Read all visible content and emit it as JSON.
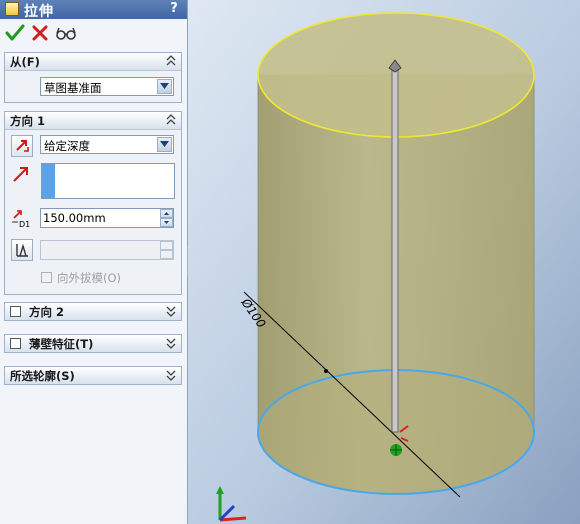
{
  "panel": {
    "title": "拉伸",
    "help_label": "?",
    "actions": {
      "ok": "ok-check-icon",
      "cancel": "cancel-x-icon",
      "preview": "detailed-preview-glasses-icon"
    },
    "from": {
      "label": "从(F)",
      "start_condition": "草图基准面"
    },
    "direction1": {
      "label": "方向 1",
      "end_condition": "给定深度",
      "depth": "150.00mm",
      "depth_icon_label": "D1",
      "draft_outward_label": "向外拔模(O)",
      "draft_outward_checked": false
    },
    "direction2": {
      "label": "方向 2",
      "checked": false
    },
    "thin_feature": {
      "label": "薄壁特征(T)",
      "checked": false
    },
    "selected_contours": {
      "label": "所选轮廓(S)"
    }
  },
  "viewport": {
    "dimension_label": "Ø100",
    "colors": {
      "cylinder_fill": "#b8b27e",
      "top_edge": "#f0e830",
      "bottom_edge": "#4aa8ea",
      "axis_arrow_red": "#e02020",
      "axis_arrow_green": "#20a020",
      "axis_arrow_blue": "#2040d0"
    }
  }
}
